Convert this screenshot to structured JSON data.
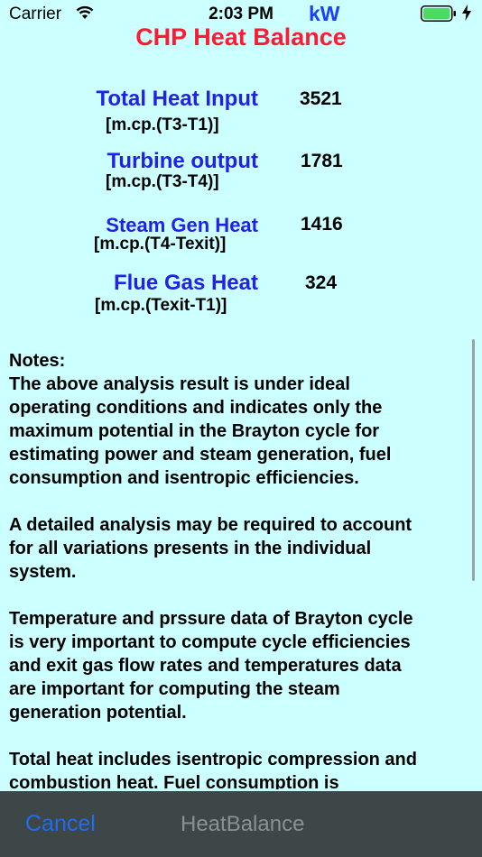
{
  "status_bar": {
    "carrier": "Carrier",
    "time": "2:03 PM",
    "wifi_icon": "wifi-icon",
    "battery_icon": "battery-icon",
    "battery_level": 1.0,
    "charging_icon": "charging-bolt-icon"
  },
  "header": {
    "unit": "kW",
    "title": "CHP Heat Balance"
  },
  "balance": [
    {
      "label": "Total Heat Input",
      "formula": "[m.cp.(T3-T1)]",
      "value": "3521"
    },
    {
      "label": "Turbine output",
      "formula": "[m.cp.(T3-T4)]",
      "value": "1781"
    },
    {
      "label": "Steam Gen Heat",
      "formula": "[m.cp.(T4-Texit)]",
      "value": "1416"
    },
    {
      "label": "Flue Gas Heat",
      "formula": "[m.cp.(Texit-T1)]",
      "value": "324"
    }
  ],
  "notes": {
    "paragraphs": [
      "Notes:\nThe above analysis result is under ideal\noperating conditions and indicates only the\nmaximum potential in the Brayton cycle for\nestimating power and steam generation, fuel\nconsumption and isentropic efficiencies.",
      "A detailed analysis may be required to account\nfor all variations presents in the individual\nsystem.",
      "Temperature and prssure data of Brayton cycle\nis very important to compute cycle efficiencies\nand exit gas flow rates and temperatures data\nare important for computing the steam\ngeneration potential.",
      "Total heat includes isentropic compression and\ncombustion heat.  Fuel consumption is"
    ]
  },
  "toolbar": {
    "cancel_label": "Cancel",
    "title": "HeatBalance"
  },
  "colors": {
    "background": "#ccffff",
    "title": "#ff1a33",
    "label": "#2121e8",
    "unit": "#1a3fff",
    "toolbar": "#3e4747",
    "cancel": "#1f6cf0",
    "battery": "#4cd964"
  }
}
